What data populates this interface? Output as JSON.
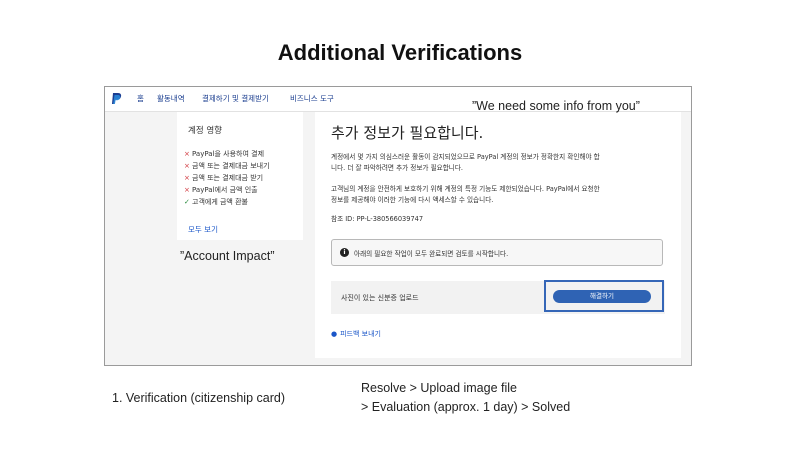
{
  "slide": {
    "title": "Additional Verifications",
    "annotation_top": "”We need some info from you”",
    "annotation_left": "”Account Impact”",
    "bottom_left": "1. Verification (citizenship card)",
    "bottom_right_line1": "Resolve > Upload image file",
    "bottom_right_line2": "> Evaluation (approx. 1 day) > Solved"
  },
  "nav": {
    "logo_icon": "paypal-logo-icon",
    "items": [
      "홈",
      "활동내역",
      "결제하기 및 결제받기",
      "비즈니스 도구"
    ]
  },
  "impact": {
    "heading": "계정 영향",
    "items": [
      {
        "mark": "×",
        "status": "restricted",
        "label": "PayPal을 사용하여 결제"
      },
      {
        "mark": "×",
        "status": "restricted",
        "label": "금액 또는 결제대금 보내기"
      },
      {
        "mark": "×",
        "status": "restricted",
        "label": "금액 또는 결제대금 받기"
      },
      {
        "mark": "×",
        "status": "restricted",
        "label": "PayPal에서 금액 인출"
      },
      {
        "mark": "✓",
        "status": "allowed",
        "label": "고객에게 금액 환불"
      }
    ],
    "see_all": "모두 보기"
  },
  "main": {
    "title": "추가 정보가 필요합니다.",
    "para1_line1": "계정에서 몇 가지 의심스러운 활동이 감지되었으므로 PayPal 계정의 정보가 정확한지 확인해야 합",
    "para1_line2": "니다. 더 잘 파악하려면 추가 정보가 필요합니다.",
    "para2_line1": "고객님의 계정을 안전하게 보호하기 위해 계정의 특정 기능도 제한되었습니다. PayPal에서 요청한",
    "para2_line2": "정보를 제공해야 이러한 기능에 다시 액세스할 수 있습니다.",
    "reference": "참조 ID: PP-L-380566039747",
    "notice": "아래의 필요한 작업이 모두 완료되면 검토를 시작합니다.",
    "task_label": "사진이 있는 신분증 업로드",
    "resolve_button": "해결하기",
    "feedback": "피드백 보내기"
  },
  "colors": {
    "accent": "#2f63b4",
    "link": "#1a56c8",
    "restricted": "#d0343b",
    "allowed": "#2a8a3e"
  }
}
